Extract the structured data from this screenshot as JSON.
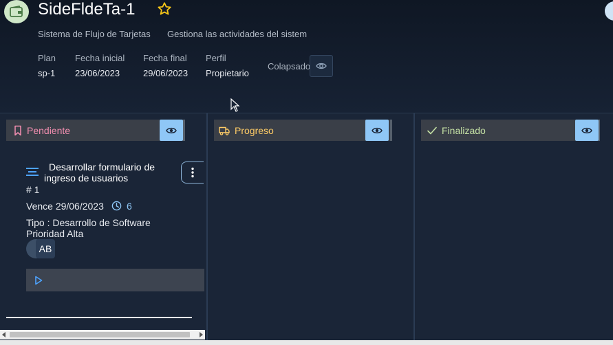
{
  "header": {
    "title": "SideFldeTa-1",
    "subtitle_name": "Sistema de Flujo de Tarjetas",
    "subtitle_desc": "Gestiona las actividades del sistem",
    "meta": [
      {
        "label": "Plan",
        "value": "sp-1"
      },
      {
        "label": "Fecha inicial",
        "value": "23/06/2023"
      },
      {
        "label": "Fecha final",
        "value": "29/06/2023"
      },
      {
        "label": "Perfil",
        "value": "Propietario"
      }
    ],
    "collapsed_label": "Colapsado"
  },
  "columns": [
    {
      "title": "Pendiente",
      "icon": "bookmark-icon",
      "color": "#f48fb1"
    },
    {
      "title": "Progreso",
      "icon": "truck-icon",
      "color": "#ffcc66"
    },
    {
      "title": "Finalizado",
      "icon": "check-icon",
      "color": "#c5e1a5"
    }
  ],
  "card": {
    "title": "Desarrollar formulario de ingreso de usuarios",
    "number": "# 1",
    "due": "Vence 29/06/2023",
    "count": "6",
    "type": "Tipo : Desarrollo de Software",
    "priority": "Prioridad Alta",
    "avatar": "AB"
  },
  "colors": {
    "accent": "#8fc7f6",
    "background": "#1a2537",
    "star": "#f5c518"
  }
}
